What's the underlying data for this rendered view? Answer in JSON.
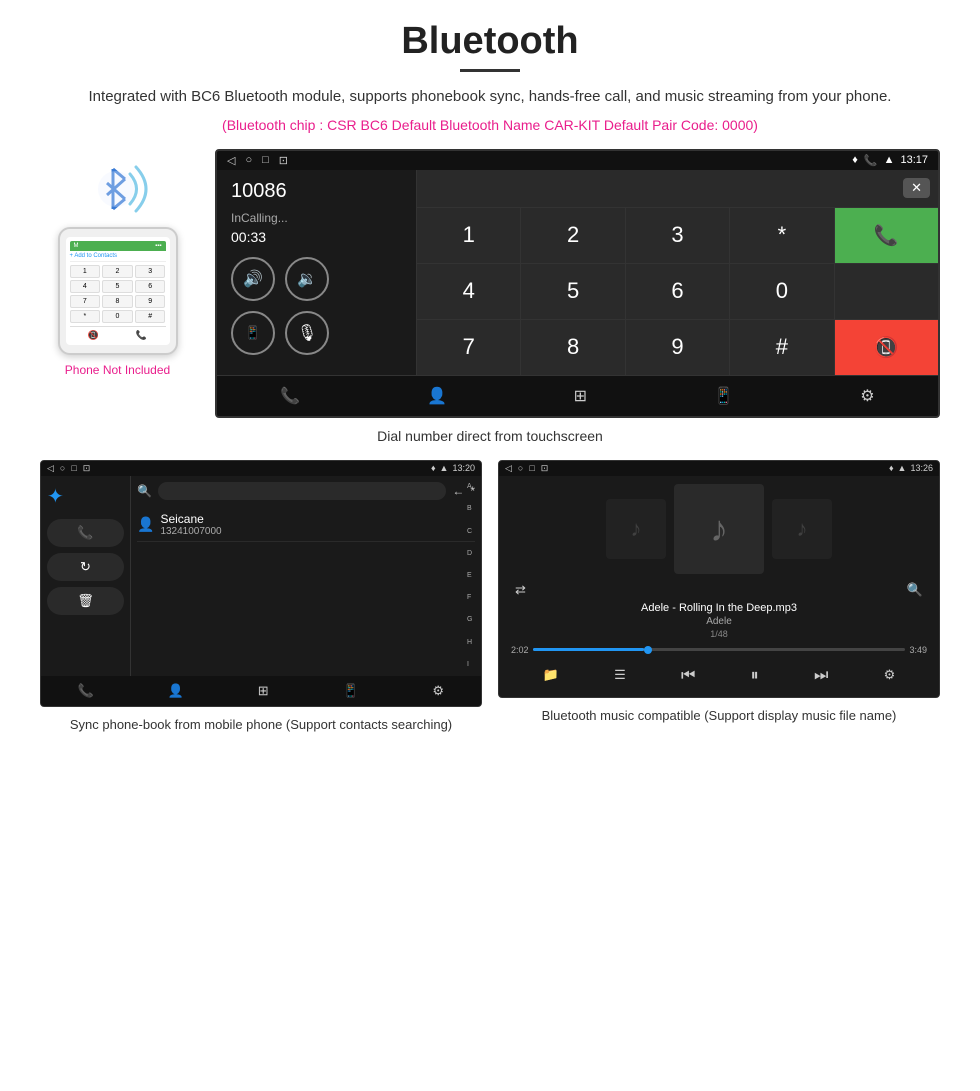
{
  "page": {
    "title": "Bluetooth",
    "subtitle": "Integrated with BC6 Bluetooth module, supports phonebook sync, hands-free call, and music streaming from your phone.",
    "chip_info": "(Bluetooth chip : CSR BC6    Default Bluetooth Name CAR-KIT    Default Pair Code: 0000)",
    "phone_not_included": "Phone Not Included",
    "caption_dial": "Dial number direct from touchscreen",
    "caption_phonebook": "Sync phone-book from mobile phone\n(Support contacts searching)",
    "caption_music": "Bluetooth music compatible\n(Support display music file name)"
  },
  "car_screen": {
    "status_time": "13:17",
    "dialer_number": "10086",
    "dialer_status": "InCalling...",
    "dialer_timer": "00:33",
    "keypad": [
      "1",
      "2",
      "3",
      "*",
      "4",
      "5",
      "6",
      "0",
      "7",
      "8",
      "9",
      "#"
    ]
  },
  "phonebook_screen": {
    "status_time": "13:20",
    "contact_name": "Seicane",
    "contact_number": "13241007000",
    "alpha_list": [
      "A",
      "B",
      "C",
      "D",
      "E",
      "F",
      "G",
      "H",
      "I"
    ]
  },
  "music_screen": {
    "status_time": "13:26",
    "song_title": "Adele - Rolling In the Deep.mp3",
    "artist": "Adele",
    "track_info": "1/48",
    "time_current": "2:02",
    "time_total": "3:49"
  },
  "phone_mockup": {
    "add_to_contacts": "+ Add to Contacts",
    "keys": [
      "1",
      "2",
      "3",
      "4",
      "5",
      "6",
      "7",
      "8",
      "9",
      "*",
      "0",
      "#"
    ]
  }
}
